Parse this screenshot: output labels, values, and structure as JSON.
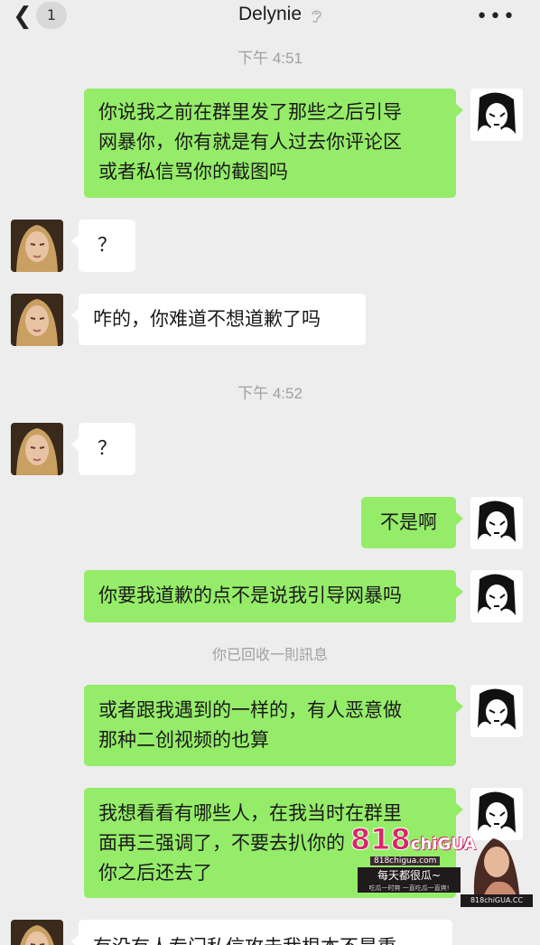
{
  "header": {
    "unread_count": "1",
    "title": "Delynie",
    "icons": [
      "chevron-left-icon",
      "ear-icon",
      "more-icon"
    ]
  },
  "timestamps": [
    "下午 4:51",
    "下午 4:52"
  ],
  "system_note": "你已回收一則訊息",
  "messages": [
    {
      "from": "me",
      "lines": [
        "你说我之前在群里发了那些之后引导",
        "网暴你，你有就是有人过去你评论区",
        "或者私信骂你的截图吗"
      ]
    },
    {
      "from": "them",
      "lines": [
        "？"
      ]
    },
    {
      "from": "them",
      "lines": [
        "咋的，你难道不想道歉了吗"
      ]
    },
    {
      "from": "them",
      "lines": [
        "？"
      ]
    },
    {
      "from": "me",
      "lines": [
        "不是啊"
      ]
    },
    {
      "from": "me",
      "lines": [
        "你要我道歉的点不是说我引导网暴吗"
      ]
    },
    {
      "from": "me",
      "lines": [
        "或者跟我遇到的一样的，有人恶意做",
        "那种二创视频的也算"
      ]
    },
    {
      "from": "me",
      "lines": [
        "我想看看有哪些人，在我当时在群里",
        "面再三强调了，不要去扒你的",
        "你之后还去了"
      ]
    },
    {
      "from": "them",
      "lines": [
        "有没有人专门私信攻击我根本不是重"
      ]
    }
  ],
  "watermark": {
    "logo_number": "818",
    "logo_word": "chiGUA",
    "url": "818chigua.com",
    "tagline": "每天都很瓜~",
    "subline": "吃瓜一时爽 一直吃瓜一直爽!",
    "badge": "818chiGUA.CC"
  },
  "colors": {
    "background": "#ededed",
    "my_bubble": "#95ec69",
    "their_bubble": "#ffffff",
    "meta_text": "#a0a0a0"
  }
}
